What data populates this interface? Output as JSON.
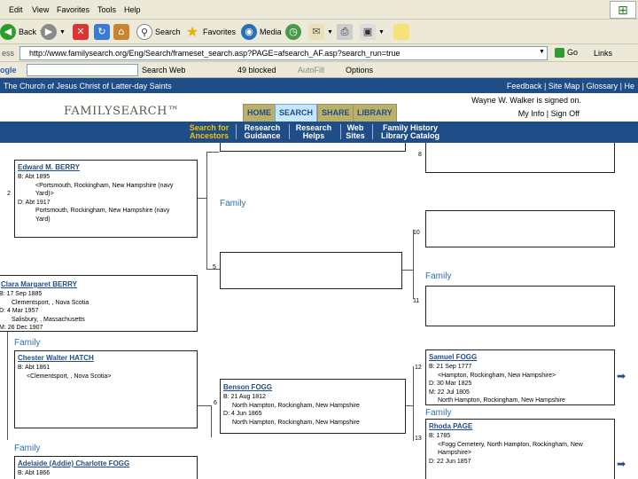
{
  "menubar": {
    "items": [
      "Edit",
      "View",
      "Favorites",
      "Tools",
      "Help"
    ]
  },
  "toolbar": {
    "back": "Back",
    "search": "Search",
    "favorites": "Favorites",
    "media": "Media"
  },
  "address": {
    "label": "ess",
    "url": "http://www.familysearch.org/Eng/Search/frameset_search.asp?PAGE=afsearch_AF.asp?search_run=true",
    "go": "Go",
    "links": "Links"
  },
  "googlebar": {
    "logo": "ogle",
    "search_web": "Search Web",
    "blocked": "49 blocked",
    "autofill": "AutoFill",
    "options": "Options"
  },
  "church": {
    "title": "The Church of Jesus Christ of Latter-day Saints",
    "links": "Feedback | Site Map | Glossary | He"
  },
  "fs": {
    "logo": "FAMILYSEARCH™",
    "tabs": [
      "HOME",
      "SEARCH",
      "SHARE",
      "LIBRARY"
    ],
    "signed_in": "Wayne W. Walker is signed on.",
    "my_links": "My Info | Sign Off"
  },
  "subnav": [
    {
      "line1": "Search for",
      "line2": "Ancestors"
    },
    {
      "line1": "Research",
      "line2": "Guidance"
    },
    {
      "line1": "Research",
      "line2": "Helps"
    },
    {
      "line1": "Web",
      "line2": "Sites"
    },
    {
      "line1": "Family History",
      "line2": "Library Catalog"
    }
  ],
  "pedigree": {
    "family_label": "Family",
    "p2": {
      "num": "2",
      "name": "Edward M. BERRY",
      "lines": [
        "B: Abt 1895",
        "<Portsmouth, Rockingham, New Hampshire (navy",
        "Yard)>",
        "D: Abt 1917",
        "Portsmouth, Rockingham, New Hampshire (navy",
        "Yard)"
      ]
    },
    "p3": {
      "name": "Clara Margaret BERRY",
      "lines": [
        "B: 17 Sep 1885",
        "Clementsport, , Nova Scotia",
        "D: 4 Mar 1957",
        "Salisbury, , Massachusetts",
        "M: 26 Dec 1907"
      ]
    },
    "p4": {
      "name": "Chester Walter HATCH",
      "lines": [
        "B: Abt 1861",
        "<Clementsport, , Nova Scotia>"
      ]
    },
    "p5": {
      "num": "5"
    },
    "p6": {
      "name": "Adelaide (Addie) Charlotte FOGG",
      "lines": [
        "B: Abt 1866"
      ]
    },
    "p_benson": {
      "num": "6",
      "name": "Benson FOGG",
      "lines": [
        "B: 21 Aug 1812",
        "North Hampton, Rockingham, New Hampshire",
        "D: 4 Jun 1865",
        "North Hampton, Rockingham, New Hampshire"
      ]
    },
    "p8": {
      "num": "8"
    },
    "p10": {
      "num": "10"
    },
    "p11": {
      "num": "11"
    },
    "p12": {
      "num": "12",
      "name": "Samuel FOGG",
      "lines": [
        "B: 21 Sep 1777",
        "<Hampton, Rockingham, New Hampshire>",
        "D: 30 Mar 1825",
        "M: 22 Jul 1805",
        "North Hampton, Rockingham, New Hampshire"
      ]
    },
    "p13": {
      "num": "13",
      "name": "Rhoda PAGE",
      "lines": [
        "B: 1785",
        "<Fogg Cemetery, North Hampton, Rockingham, New",
        "Hampshire>",
        "D: 22 Jun 1857"
      ]
    }
  }
}
